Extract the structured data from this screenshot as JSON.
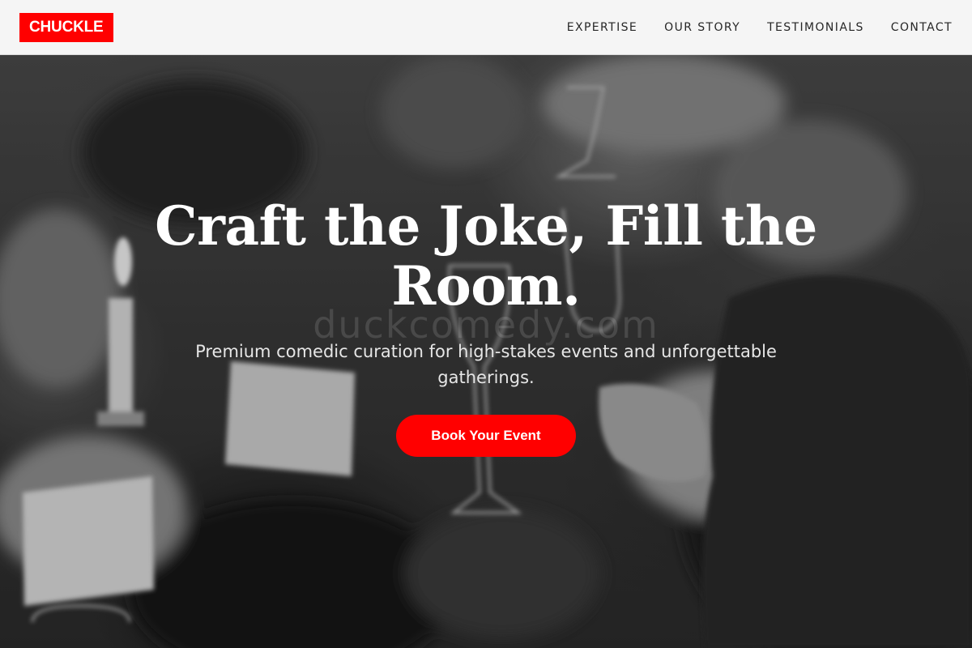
{
  "brand": {
    "logo_text": "CHUCKLE",
    "accent_color": "#ff0000"
  },
  "nav": {
    "items": [
      {
        "label": "EXPERTISE"
      },
      {
        "label": "OUR STORY"
      },
      {
        "label": "TESTIMONIALS"
      },
      {
        "label": "CONTACT"
      }
    ]
  },
  "hero": {
    "title": "Craft the Joke, Fill the Room.",
    "subtitle": "Premium comedic curation for high-stakes events and unforgettable gatherings.",
    "cta_label": "Book Your Event",
    "watermark": "duckcomedy.com",
    "background": "grayscale-event-photo"
  }
}
